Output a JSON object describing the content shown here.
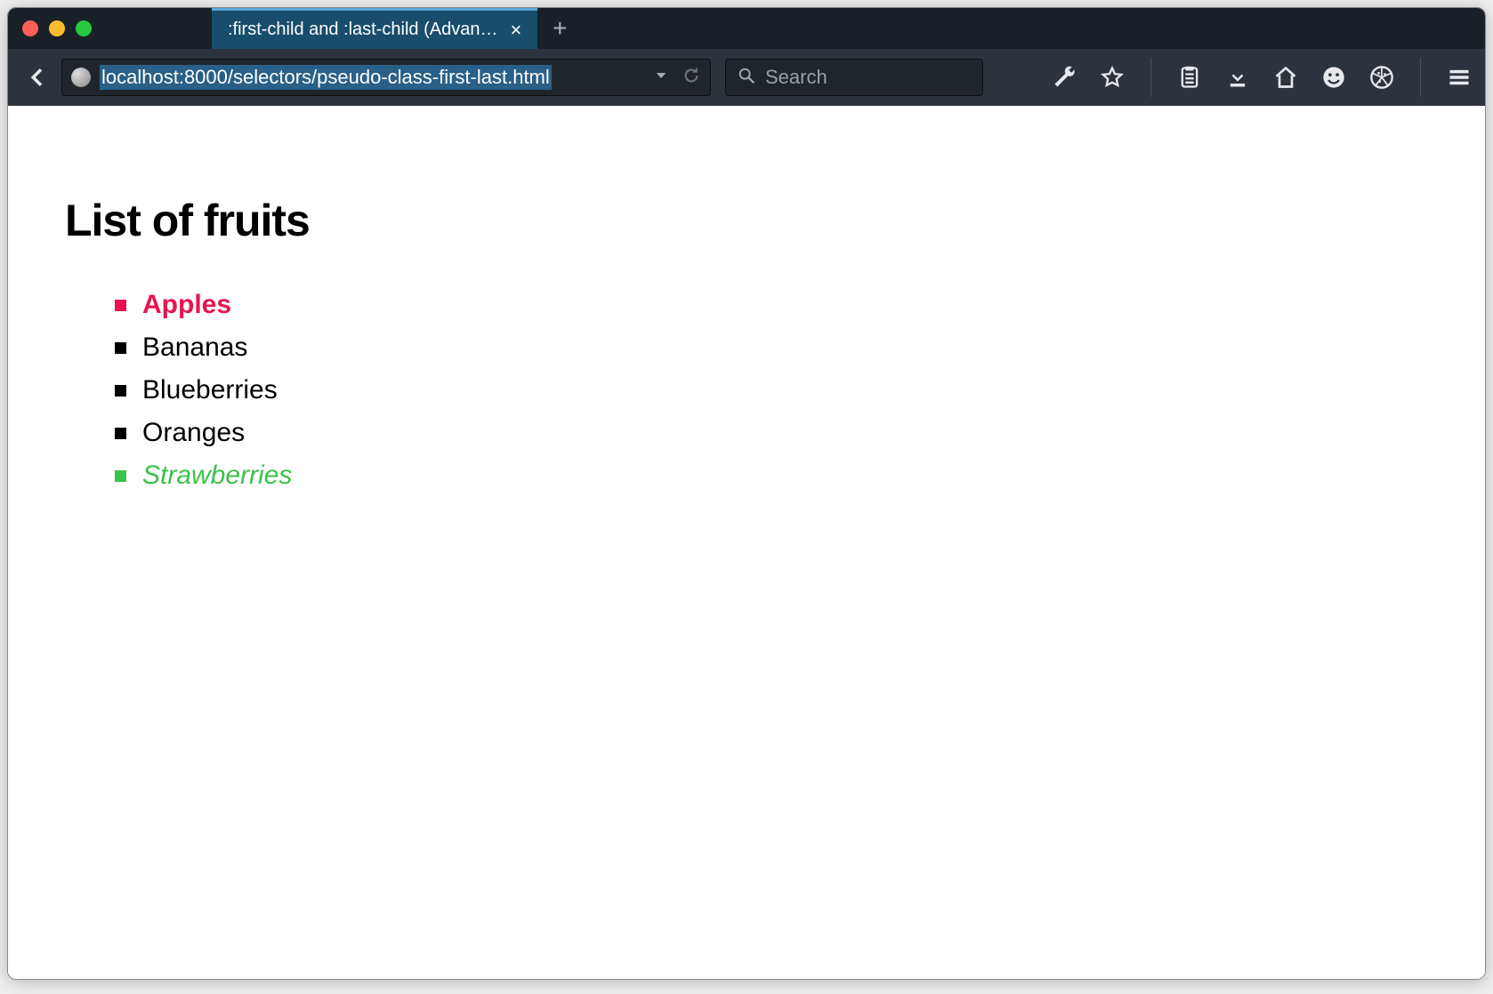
{
  "window": {
    "tab_title": ":first-child and :last-child (Advan…",
    "traffic": {
      "close": "close",
      "minimize": "minimize",
      "zoom": "zoom"
    }
  },
  "toolbar": {
    "url": "localhost:8000/selectors/pseudo-class-first-last.html",
    "search_placeholder": "Search"
  },
  "page": {
    "heading": "List of fruits",
    "items": [
      "Apples",
      "Bananas",
      "Blueberries",
      "Oranges",
      "Strawberries"
    ]
  },
  "colors": {
    "first_item": "#e6144e",
    "last_item": "#3bc24a",
    "chrome_bg": "#2d333c",
    "tab_active": "#184d6b"
  }
}
